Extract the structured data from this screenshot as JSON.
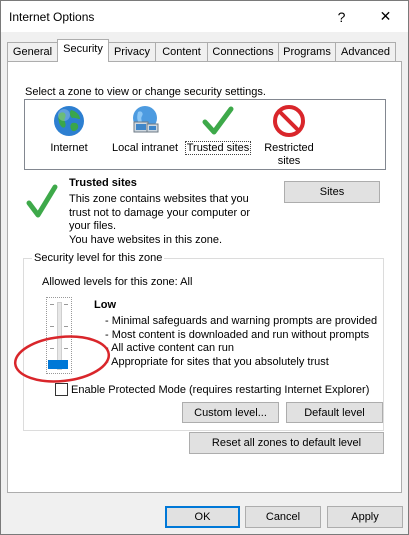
{
  "window": {
    "title": "Internet Options",
    "help_glyph": "?",
    "close_glyph": "✕"
  },
  "tabs": [
    {
      "label": "General"
    },
    {
      "label": "Security",
      "active": true
    },
    {
      "label": "Privacy"
    },
    {
      "label": "Content"
    },
    {
      "label": "Connections"
    },
    {
      "label": "Programs"
    },
    {
      "label": "Advanced"
    }
  ],
  "security": {
    "zone_prompt": "Select a zone to view or change security settings.",
    "zones": [
      {
        "label": "Internet",
        "icon": "globe-icon"
      },
      {
        "label": "Local intranet",
        "icon": "network-computer-icon"
      },
      {
        "label": "Trusted sites",
        "icon": "green-check-icon",
        "selected": true
      },
      {
        "label_line1": "Restricted",
        "label_line2": "sites",
        "icon": "restricted-icon"
      }
    ],
    "selected_zone": {
      "title": "Trusted sites",
      "description_lines": [
        "This zone contains websites that you",
        "trust not to damage your computer or",
        "your files.",
        "You have websites in this zone."
      ],
      "sites_button": "Sites"
    },
    "level_group": {
      "title": "Security level for this zone",
      "allowed_levels": "Allowed levels for this zone: All",
      "level_name": "Low",
      "level_points": [
        "- Minimal safeguards and warning prompts are provided",
        "- Most content is downloaded and run without prompts",
        "- All active content can run",
        "- Appropriate for sites that you absolutely trust"
      ],
      "slider_level_fraction": 0.0,
      "protected_mode_label": "Enable Protected Mode (requires restarting Internet Explorer)",
      "protected_mode_checked": false,
      "custom_level_button": "Custom level...",
      "default_level_button": "Default level"
    },
    "reset_all_button": "Reset all zones to default level"
  },
  "footer": {
    "ok": "OK",
    "cancel": "Cancel",
    "apply": "Apply"
  },
  "colors": {
    "accent": "#0078d7",
    "annotation_circle": "#d9262b"
  }
}
